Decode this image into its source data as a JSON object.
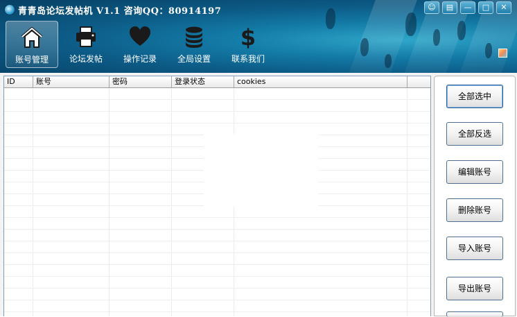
{
  "window": {
    "title": "青青岛论坛发帖机 V1.1 咨询QQ：80914197",
    "controls": [
      "chat",
      "menu",
      "minimize",
      "maximize",
      "close"
    ]
  },
  "nav": {
    "items": [
      {
        "label": "账号管理",
        "icon": "home-icon",
        "active": true
      },
      {
        "label": "论坛发帖",
        "icon": "printer-icon",
        "active": false
      },
      {
        "label": "操作记录",
        "icon": "heart-icon",
        "active": false
      },
      {
        "label": "全局设置",
        "icon": "coins-icon",
        "active": false
      },
      {
        "label": "联系我们",
        "icon": "dollar-icon",
        "active": false
      }
    ]
  },
  "table": {
    "columns": [
      "ID",
      "账号",
      "密码",
      "登录状态",
      "cookies"
    ],
    "rows": []
  },
  "sidebar": {
    "buttons": [
      "全部选中",
      "全部反选",
      "编辑账号",
      "删除账号",
      "导入账号",
      "导出账号"
    ]
  },
  "colors": {
    "header_dark": "#073f63",
    "header_light": "#2fa6c9",
    "button_border": "#4f6f92"
  }
}
